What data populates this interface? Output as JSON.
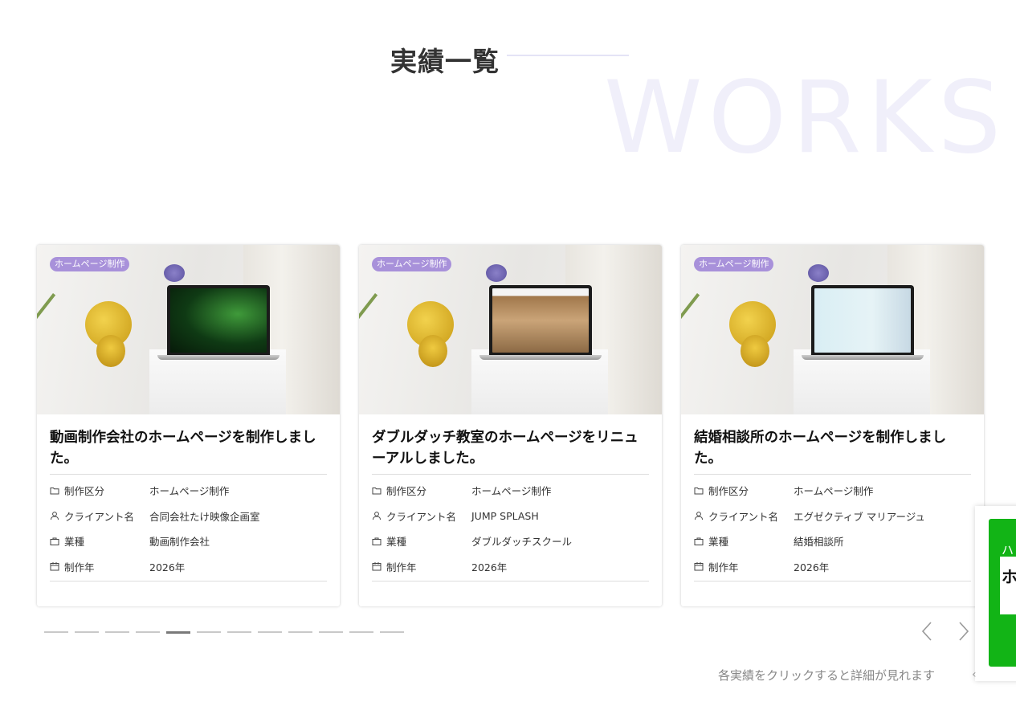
{
  "header": {
    "title": "実績一覧",
    "bg_word": "WORKS"
  },
  "colors": {
    "badge": "#a891da",
    "accent_line": "#e4e3f6",
    "bg_word": "#f0effa",
    "line_green": "#12b416"
  },
  "cards": [
    {
      "badge": "ホームページ制作",
      "title": "動画制作会社のホームページを制作しました。",
      "meta": [
        {
          "icon": "folder-icon",
          "key": "制作区分",
          "value": "ホームページ制作"
        },
        {
          "icon": "user-icon",
          "key": "クライアント名",
          "value": "合同会社たけ映像企画室"
        },
        {
          "icon": "briefcase-icon",
          "key": "業種",
          "value": "動画制作会社"
        },
        {
          "icon": "calendar-icon",
          "key": "制作年",
          "value": "2026年"
        }
      ]
    },
    {
      "badge": "ホームページ制作",
      "title": "ダブルダッチ教室のホームページをリニューアルしました。",
      "meta": [
        {
          "icon": "folder-icon",
          "key": "制作区分",
          "value": "ホームページ制作"
        },
        {
          "icon": "user-icon",
          "key": "クライアント名",
          "value": "JUMP SPLASH"
        },
        {
          "icon": "briefcase-icon",
          "key": "業種",
          "value": "ダブルダッチスクール"
        },
        {
          "icon": "calendar-icon",
          "key": "制作年",
          "value": "2026年"
        }
      ]
    },
    {
      "badge": "ホームページ制作",
      "title": "結婚相談所のホームページを制作しました。",
      "meta": [
        {
          "icon": "folder-icon",
          "key": "制作区分",
          "value": "ホームページ制作"
        },
        {
          "icon": "user-icon",
          "key": "クライアント名",
          "value": "エグゼクティブ マリアージュ"
        },
        {
          "icon": "briefcase-icon",
          "key": "業種",
          "value": "結婚相談所"
        },
        {
          "icon": "calendar-icon",
          "key": "制作年",
          "value": "2026年"
        }
      ]
    }
  ],
  "pagination": {
    "total": 12,
    "active_index": 4
  },
  "nav": {
    "prev_icon": "chevron-left-icon",
    "next_icon": "chevron-right-icon"
  },
  "hint": "各実績をクリックすると詳細が見れます",
  "side_widget": {
    "char_top": "ハ",
    "char_mid": "ホ",
    "char_bottom": "‹"
  }
}
